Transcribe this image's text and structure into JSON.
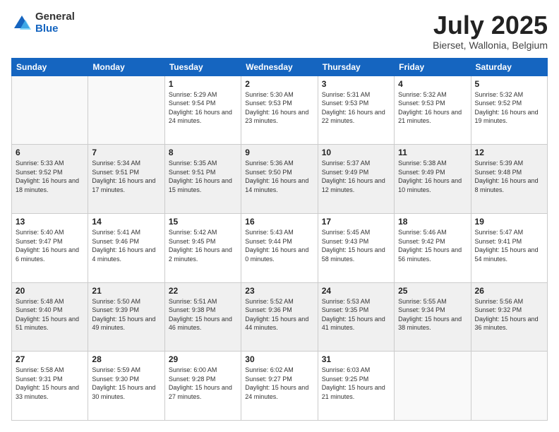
{
  "header": {
    "logo_general": "General",
    "logo_blue": "Blue",
    "month_title": "July 2025",
    "subtitle": "Bierset, Wallonia, Belgium"
  },
  "days_of_week": [
    "Sunday",
    "Monday",
    "Tuesday",
    "Wednesday",
    "Thursday",
    "Friday",
    "Saturday"
  ],
  "weeks": [
    [
      {
        "day": "",
        "sunrise": "",
        "sunset": "",
        "daylight": ""
      },
      {
        "day": "",
        "sunrise": "",
        "sunset": "",
        "daylight": ""
      },
      {
        "day": "1",
        "sunrise": "Sunrise: 5:29 AM",
        "sunset": "Sunset: 9:54 PM",
        "daylight": "Daylight: 16 hours and 24 minutes."
      },
      {
        "day": "2",
        "sunrise": "Sunrise: 5:30 AM",
        "sunset": "Sunset: 9:53 PM",
        "daylight": "Daylight: 16 hours and 23 minutes."
      },
      {
        "day": "3",
        "sunrise": "Sunrise: 5:31 AM",
        "sunset": "Sunset: 9:53 PM",
        "daylight": "Daylight: 16 hours and 22 minutes."
      },
      {
        "day": "4",
        "sunrise": "Sunrise: 5:32 AM",
        "sunset": "Sunset: 9:53 PM",
        "daylight": "Daylight: 16 hours and 21 minutes."
      },
      {
        "day": "5",
        "sunrise": "Sunrise: 5:32 AM",
        "sunset": "Sunset: 9:52 PM",
        "daylight": "Daylight: 16 hours and 19 minutes."
      }
    ],
    [
      {
        "day": "6",
        "sunrise": "Sunrise: 5:33 AM",
        "sunset": "Sunset: 9:52 PM",
        "daylight": "Daylight: 16 hours and 18 minutes."
      },
      {
        "day": "7",
        "sunrise": "Sunrise: 5:34 AM",
        "sunset": "Sunset: 9:51 PM",
        "daylight": "Daylight: 16 hours and 17 minutes."
      },
      {
        "day": "8",
        "sunrise": "Sunrise: 5:35 AM",
        "sunset": "Sunset: 9:51 PM",
        "daylight": "Daylight: 16 hours and 15 minutes."
      },
      {
        "day": "9",
        "sunrise": "Sunrise: 5:36 AM",
        "sunset": "Sunset: 9:50 PM",
        "daylight": "Daylight: 16 hours and 14 minutes."
      },
      {
        "day": "10",
        "sunrise": "Sunrise: 5:37 AM",
        "sunset": "Sunset: 9:49 PM",
        "daylight": "Daylight: 16 hours and 12 minutes."
      },
      {
        "day": "11",
        "sunrise": "Sunrise: 5:38 AM",
        "sunset": "Sunset: 9:49 PM",
        "daylight": "Daylight: 16 hours and 10 minutes."
      },
      {
        "day": "12",
        "sunrise": "Sunrise: 5:39 AM",
        "sunset": "Sunset: 9:48 PM",
        "daylight": "Daylight: 16 hours and 8 minutes."
      }
    ],
    [
      {
        "day": "13",
        "sunrise": "Sunrise: 5:40 AM",
        "sunset": "Sunset: 9:47 PM",
        "daylight": "Daylight: 16 hours and 6 minutes."
      },
      {
        "day": "14",
        "sunrise": "Sunrise: 5:41 AM",
        "sunset": "Sunset: 9:46 PM",
        "daylight": "Daylight: 16 hours and 4 minutes."
      },
      {
        "day": "15",
        "sunrise": "Sunrise: 5:42 AM",
        "sunset": "Sunset: 9:45 PM",
        "daylight": "Daylight: 16 hours and 2 minutes."
      },
      {
        "day": "16",
        "sunrise": "Sunrise: 5:43 AM",
        "sunset": "Sunset: 9:44 PM",
        "daylight": "Daylight: 16 hours and 0 minutes."
      },
      {
        "day": "17",
        "sunrise": "Sunrise: 5:45 AM",
        "sunset": "Sunset: 9:43 PM",
        "daylight": "Daylight: 15 hours and 58 minutes."
      },
      {
        "day": "18",
        "sunrise": "Sunrise: 5:46 AM",
        "sunset": "Sunset: 9:42 PM",
        "daylight": "Daylight: 15 hours and 56 minutes."
      },
      {
        "day": "19",
        "sunrise": "Sunrise: 5:47 AM",
        "sunset": "Sunset: 9:41 PM",
        "daylight": "Daylight: 15 hours and 54 minutes."
      }
    ],
    [
      {
        "day": "20",
        "sunrise": "Sunrise: 5:48 AM",
        "sunset": "Sunset: 9:40 PM",
        "daylight": "Daylight: 15 hours and 51 minutes."
      },
      {
        "day": "21",
        "sunrise": "Sunrise: 5:50 AM",
        "sunset": "Sunset: 9:39 PM",
        "daylight": "Daylight: 15 hours and 49 minutes."
      },
      {
        "day": "22",
        "sunrise": "Sunrise: 5:51 AM",
        "sunset": "Sunset: 9:38 PM",
        "daylight": "Daylight: 15 hours and 46 minutes."
      },
      {
        "day": "23",
        "sunrise": "Sunrise: 5:52 AM",
        "sunset": "Sunset: 9:36 PM",
        "daylight": "Daylight: 15 hours and 44 minutes."
      },
      {
        "day": "24",
        "sunrise": "Sunrise: 5:53 AM",
        "sunset": "Sunset: 9:35 PM",
        "daylight": "Daylight: 15 hours and 41 minutes."
      },
      {
        "day": "25",
        "sunrise": "Sunrise: 5:55 AM",
        "sunset": "Sunset: 9:34 PM",
        "daylight": "Daylight: 15 hours and 38 minutes."
      },
      {
        "day": "26",
        "sunrise": "Sunrise: 5:56 AM",
        "sunset": "Sunset: 9:32 PM",
        "daylight": "Daylight: 15 hours and 36 minutes."
      }
    ],
    [
      {
        "day": "27",
        "sunrise": "Sunrise: 5:58 AM",
        "sunset": "Sunset: 9:31 PM",
        "daylight": "Daylight: 15 hours and 33 minutes."
      },
      {
        "day": "28",
        "sunrise": "Sunrise: 5:59 AM",
        "sunset": "Sunset: 9:30 PM",
        "daylight": "Daylight: 15 hours and 30 minutes."
      },
      {
        "day": "29",
        "sunrise": "Sunrise: 6:00 AM",
        "sunset": "Sunset: 9:28 PM",
        "daylight": "Daylight: 15 hours and 27 minutes."
      },
      {
        "day": "30",
        "sunrise": "Sunrise: 6:02 AM",
        "sunset": "Sunset: 9:27 PM",
        "daylight": "Daylight: 15 hours and 24 minutes."
      },
      {
        "day": "31",
        "sunrise": "Sunrise: 6:03 AM",
        "sunset": "Sunset: 9:25 PM",
        "daylight": "Daylight: 15 hours and 21 minutes."
      },
      {
        "day": "",
        "sunrise": "",
        "sunset": "",
        "daylight": ""
      },
      {
        "day": "",
        "sunrise": "",
        "sunset": "",
        "daylight": ""
      }
    ]
  ]
}
